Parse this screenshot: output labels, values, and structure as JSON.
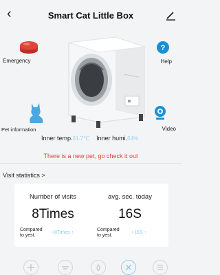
{
  "header": {
    "title": "Smart Cat Little Box",
    "back_icon": "chevron-left-icon",
    "edit_icon": "pencil-icon"
  },
  "actions": {
    "emergency_label": "Emergency",
    "help_label": "Help",
    "pet_info_label": "Pet information",
    "video_label": "Video"
  },
  "environment": {
    "temp_label": "Inner temp.",
    "temp_value": "31.7℃",
    "humidity_label": "Inner humi.",
    "humidity_value": "54%"
  },
  "notice": "There is a new pet, go check it out",
  "visit_statistics": {
    "link_label": "Visit statistics >",
    "visits": {
      "header": "Number of visits",
      "value": "8Times",
      "compare_label": "Compared to yest.",
      "delta": "+8Times ↑"
    },
    "avg": {
      "header": "avg. sec. today",
      "value": "16S",
      "compare_label": "Compared to yest.",
      "delta": "+16S ↑"
    }
  },
  "colors": {
    "accent": "#8ecbef",
    "alert": "#e34242",
    "emergency": "#e0453a",
    "help": "#1b8fd6"
  },
  "bottom_nav": {
    "icons": [
      "clean-icon",
      "level-icon",
      "deodorize-icon",
      "settings-icon",
      "menu-icon"
    ]
  }
}
